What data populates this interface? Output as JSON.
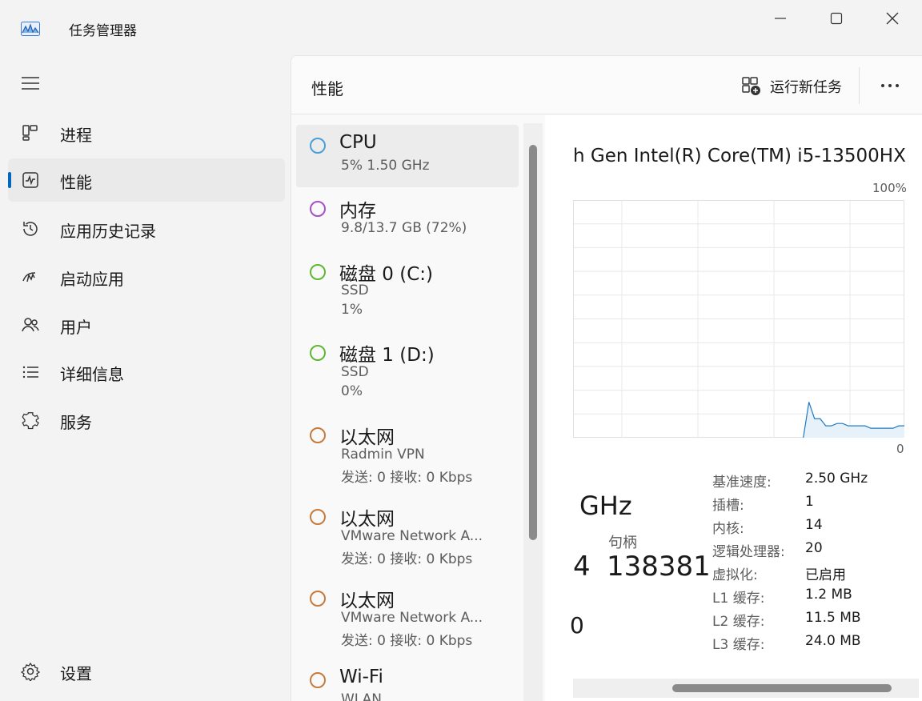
{
  "window": {
    "title": "任务管理器"
  },
  "sidebar": {
    "items": [
      {
        "label": "进程",
        "icon": "processes-icon"
      },
      {
        "label": "性能",
        "icon": "performance-icon",
        "active": true
      },
      {
        "label": "应用历史记录",
        "icon": "history-icon"
      },
      {
        "label": "启动应用",
        "icon": "startup-icon"
      },
      {
        "label": "用户",
        "icon": "users-icon"
      },
      {
        "label": "详细信息",
        "icon": "details-icon"
      },
      {
        "label": "服务",
        "icon": "services-icon"
      }
    ],
    "settings_label": "设置"
  },
  "header": {
    "title": "性能",
    "run_task_label": "运行新任务",
    "more_label": "..."
  },
  "devices": [
    {
      "name": "CPU",
      "line1": "5%  1.50 GHz",
      "color": "#4a9fd8"
    },
    {
      "name": "内存",
      "line1": "9.8/13.7 GB (72%)",
      "color": "#a64fc8"
    },
    {
      "name": "磁盘 0 (C:)",
      "line1": "SSD",
      "line2": "1%",
      "color": "#5fb832"
    },
    {
      "name": "磁盘 1 (D:)",
      "line1": "SSD",
      "line2": "0%",
      "color": "#5fb832"
    },
    {
      "name": "以太网",
      "line1": "Radmin VPN",
      "line2": "发送: 0 接收: 0 Kbps",
      "color": "#c87a3a"
    },
    {
      "name": "以太网",
      "line1": "VMware Network A...",
      "line2": "发送: 0 接收: 0 Kbps",
      "color": "#c87a3a"
    },
    {
      "name": "以太网",
      "line1": "VMware Network A...",
      "line2": "发送: 0 接收: 0 Kbps",
      "color": "#c87a3a"
    },
    {
      "name": "Wi-Fi",
      "line1": "WLAN",
      "color": "#c87a3a"
    }
  ],
  "detail": {
    "cpu_model": "h Gen Intel(R) Core(TM) i5-13500HX",
    "pct_max": "100%",
    "pct_min": "0",
    "speed_fragment": "GHz",
    "handle_label": "句柄",
    "handle_value": "138381",
    "frag_a": "4",
    "frag_b": "0",
    "specs": [
      {
        "label": "基准速度:",
        "value": "2.50 GHz"
      },
      {
        "label": "插槽:",
        "value": "1"
      },
      {
        "label": "内核:",
        "value": "14"
      },
      {
        "label": "逻辑处理器:",
        "value": "20"
      },
      {
        "label": "虚拟化:",
        "value": "已启用"
      },
      {
        "label": "L1 缓存:",
        "value": "1.2 MB"
      },
      {
        "label": "L2 缓存:",
        "value": "11.5 MB"
      },
      {
        "label": "L3 缓存:",
        "value": "24.0 MB"
      }
    ]
  },
  "chart_data": {
    "type": "area",
    "y_range": [
      0,
      100
    ],
    "values": [
      0,
      0,
      0,
      0,
      0,
      0,
      0,
      0,
      0,
      0,
      0,
      0,
      0,
      0,
      0,
      0,
      0,
      0,
      0,
      0,
      0,
      0,
      0,
      0,
      0,
      0,
      0,
      0,
      0,
      0,
      0,
      0,
      0,
      0,
      0,
      0,
      0,
      0,
      0,
      0,
      0,
      0,
      15,
      8,
      8,
      5,
      5,
      6,
      6,
      5,
      5,
      5,
      5,
      4,
      4,
      4,
      4,
      4,
      5,
      5
    ],
    "line_color": "#1f7ac2",
    "fill_color": "#e6f1fa",
    "grid": true
  },
  "colors": {
    "accent": "#0067c0"
  }
}
